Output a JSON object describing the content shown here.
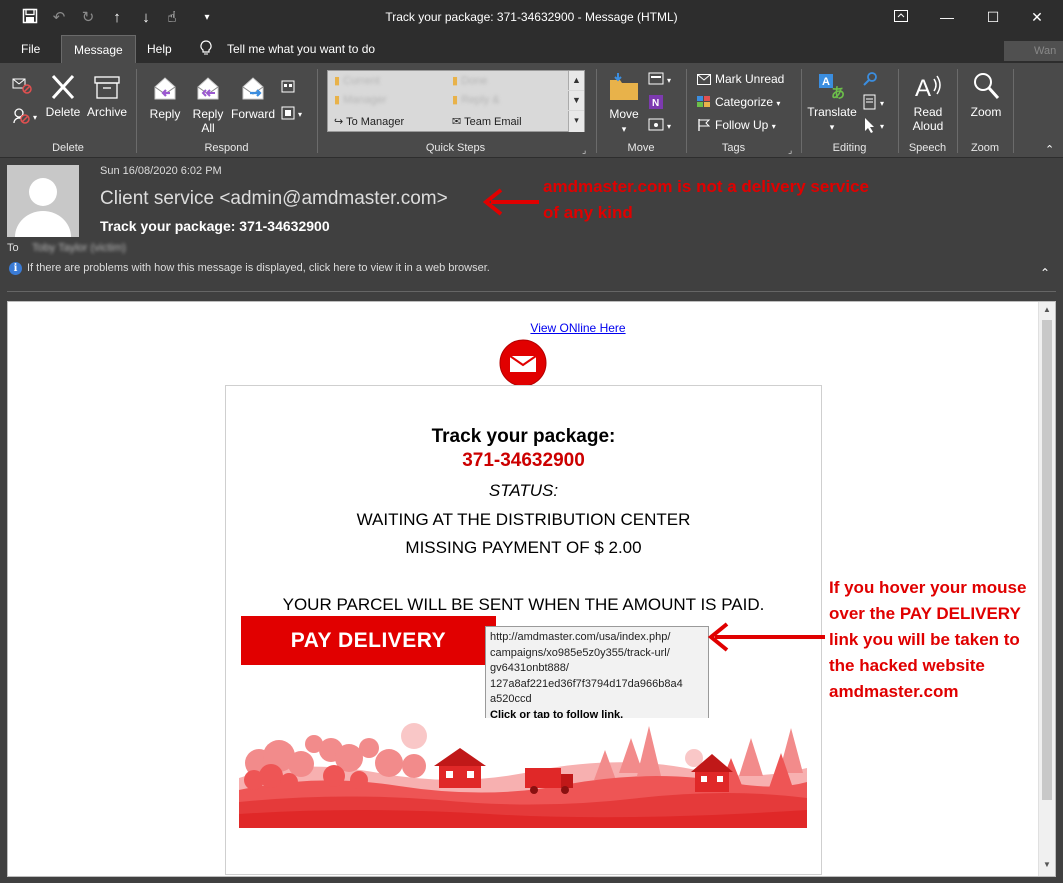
{
  "window": {
    "title": "Track your package: 371-34632900  -  Message (HTML)"
  },
  "tabs": [
    {
      "label": "File"
    },
    {
      "label": "Message"
    },
    {
      "label": "Help"
    },
    {
      "label": "Tell me what you want to do"
    }
  ],
  "search_hint": "Wan",
  "ribbon": {
    "delete_group": {
      "label": "Delete",
      "delete": "Delete",
      "archive": "Archive"
    },
    "respond_group": {
      "label": "Respond",
      "reply": "Reply",
      "reply_all_1": "Reply",
      "reply_all_2": "All",
      "forward": "Forward"
    },
    "quick_steps": {
      "label": "Quick Steps",
      "items": [
        "Current",
        "Manager",
        "Team Email",
        "Done",
        "Reply & Delete"
      ],
      "to_manager": "To Manager",
      "team_email": "Team Email",
      "blurred": [
        "Current",
        "Manager",
        "Done",
        "Reply &"
      ]
    },
    "move_group": {
      "label": "Move",
      "move": "Move"
    },
    "tags_group": {
      "label": "Tags",
      "mark_unread": "Mark Unread",
      "categorize": "Categorize",
      "follow_up": "Follow Up"
    },
    "editing_group": {
      "label": "Editing",
      "translate": "Translate"
    },
    "speech_group": {
      "label": "Speech",
      "read_aloud_1": "Read",
      "read_aloud_2": "Aloud"
    },
    "zoom_group": {
      "label": "Zoom",
      "zoom": "Zoom"
    }
  },
  "message": {
    "date": "Sun 16/08/2020 6:02 PM",
    "sender": "Client service <admin@amdmaster.com>",
    "subject": "Track your package: 371-34632900",
    "to_label": "To",
    "to_value": "Toby Taylor (victim)",
    "info_bar": "If there are problems with how this message is displayed, click here to view it in a web browser."
  },
  "annotations": {
    "sender_note_1": "amdmaster.com is not a delivery service",
    "sender_note_2": "of any kind",
    "link_note": [
      "If you hover your mouse",
      "over the PAY DELIVERY",
      "link you will be taken to",
      "the hacked website",
      "amdmaster.com"
    ],
    "color": "#e00000"
  },
  "email": {
    "view_online": "View ONline Here",
    "heading": "Track your package:",
    "tracking": "371-34632900",
    "status_label": "STATUS:",
    "status_1": "WAITING AT THE DISTRIBUTION CENTER",
    "status_2": "MISSING PAYMENT OF $ 2.00",
    "notice": "YOUR PARCEL WILL BE SENT WHEN THE AMOUNT IS PAID.",
    "pay_button": "PAY DELIVERY",
    "brand_color": "#e10000"
  },
  "tooltip": {
    "lines": [
      "http://amdmaster.com/usa/index.php/",
      "campaigns/xo985e5z0y355/track-url/",
      "gv6431onbt888/",
      "127a8af221ed36f7f3794d17da966b8a4",
      "a520ccd"
    ],
    "action": "Click or tap to follow link."
  }
}
